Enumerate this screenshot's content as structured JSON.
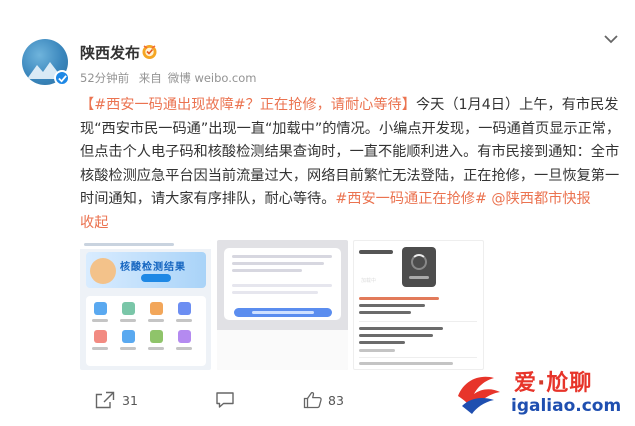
{
  "post": {
    "author": "陕西发布",
    "time": "52分钟前",
    "source_prefix": "来自",
    "source": "微博 weibo.com",
    "text": {
      "tag_open": "【",
      "tag_text": "#西安一码通出现故障#",
      "after_tag": "？正在抢修，请耐心等待",
      "tag_close": "】",
      "body_1": "今天（1月4日）上午，有市民发现“西安市民一码通”出现一直“加载中”的情况。小编点开发现，一码通首页显示正常，但点击个人电子码和核酸检测结果查询时，一直不能顺利进入。有市民接到通知：全市核酸检测应急平台因当前流量过大，网络目前繁忙无法登陆，正在抢修，一旦恢复第一时间通知，请大家有序排队，耐心等待。",
      "hashtag_2": "#西安一码通正在抢修#",
      "mention": "@陕西都市快报",
      "fold_label": "收起"
    }
  },
  "images": {
    "shot1_banner": "核酸检测结果",
    "loader_label": "加载中"
  },
  "actions": {
    "share_count": "31",
    "comment_count": "",
    "like_count": "83"
  },
  "watermark": {
    "brand_a": "爱",
    "brand_dot": "·",
    "brand_b": "尬聊",
    "url": "igaliao.com"
  },
  "colors": {
    "link": "#eb7350",
    "brand_red": "#e7342a",
    "brand_blue": "#1f4fb0"
  },
  "icons": [
    "more-chevron-icon",
    "verified-badge-icon",
    "user-medal-icon",
    "share-icon",
    "comment-icon",
    "like-icon"
  ]
}
